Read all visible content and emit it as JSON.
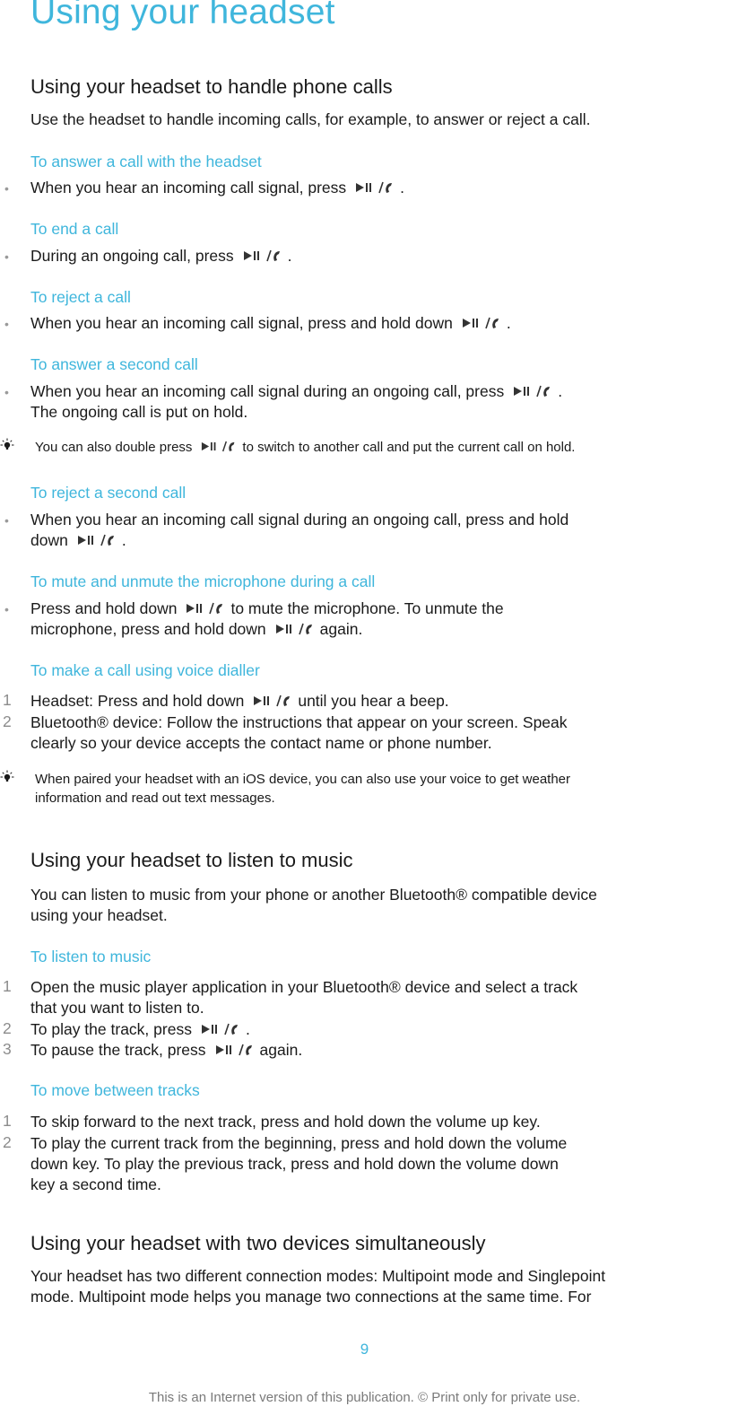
{
  "page": {
    "title": "Using your headset",
    "page_number": "9",
    "footer": "This is an Internet version of this publication. © Print only for private use."
  },
  "icons": {
    "key": "play-pause-call-key-icon",
    "tip": "lightbulb-tip-icon",
    "bullet": "•"
  },
  "colors": {
    "accent": "#3fb6dc",
    "text": "#1a1a1a",
    "muted": "#8c8c8c"
  },
  "sections": [
    {
      "heading": "Using your headset to handle phone calls",
      "intro": "Use the headset to handle incoming calls, for example, to answer or reject a call.",
      "procedures": [
        {
          "title": "To answer a call with the headset",
          "items": [
            {
              "before": "When you hear an incoming call signal, press",
              "after": "."
            }
          ]
        },
        {
          "title": "To end a call",
          "items": [
            {
              "before": "During an ongoing call, press",
              "after": "."
            }
          ]
        },
        {
          "title": "To reject a call",
          "items": [
            {
              "before": "When you hear an incoming call signal, press and hold down",
              "after": "."
            }
          ]
        },
        {
          "title": "To answer a second call",
          "items": [
            {
              "before": "When you hear an incoming call signal during an ongoing call, press",
              "after": ".",
              "line2": "The ongoing call is put on hold."
            }
          ],
          "tip": {
            "before": "You can also double press",
            "after": "to switch to another call and put the current call on hold."
          }
        },
        {
          "title": "To reject a second call",
          "items": [
            {
              "line1": "When you hear an incoming call signal during an ongoing call, press and hold",
              "before": "down",
              "after": "."
            }
          ]
        },
        {
          "title": "To mute and unmute the microphone during a call",
          "items": [
            {
              "before": "Press and hold down",
              "after": "to mute the microphone. To unmute the",
              "before2": "microphone, press and hold down",
              "after2": "again."
            }
          ]
        },
        {
          "title": "To make a call using voice dialler",
          "steps": [
            {
              "n": "1",
              "before": "Headset: Press and hold down",
              "after": "until you hear a beep."
            },
            {
              "n": "2",
              "line1": "Bluetooth® device: Follow the instructions that appear on your screen. Speak",
              "line2": "clearly so your device accepts the contact name or phone number."
            }
          ],
          "tip": {
            "line1": "When paired your headset with an iOS device, you can also use your voice to get weather",
            "line2": "information and read out text messages."
          }
        }
      ]
    },
    {
      "heading": "Using your headset to listen to music",
      "intro_line1": "You can listen to music from your phone or another Bluetooth® compatible device",
      "intro_line2": "using your headset.",
      "procedures": [
        {
          "title": "To listen to music",
          "steps": [
            {
              "n": "1",
              "line1": "Open the music player application in your Bluetooth® device and select a track",
              "line2": "that you want to listen to."
            },
            {
              "n": "2",
              "before": "To play the track, press",
              "after": "."
            },
            {
              "n": "3",
              "before": "To pause the track, press",
              "after": "again."
            }
          ]
        },
        {
          "title": "To move between tracks",
          "steps": [
            {
              "n": "1",
              "line1": "To skip forward to the next track, press and hold down the volume up key."
            },
            {
              "n": "2",
              "line1": "To play the current track from the beginning, press and hold down the volume",
              "line2": "down key. To play the previous track, press and hold down the volume down",
              "line3": "key a second time."
            }
          ]
        }
      ]
    },
    {
      "heading": "Using your headset with two devices simultaneously",
      "intro_line1": "Your headset has two different connection modes: Multipoint mode and Singlepoint",
      "intro_line2": "mode. Multipoint mode helps you manage two connections at the same time. For"
    }
  ]
}
